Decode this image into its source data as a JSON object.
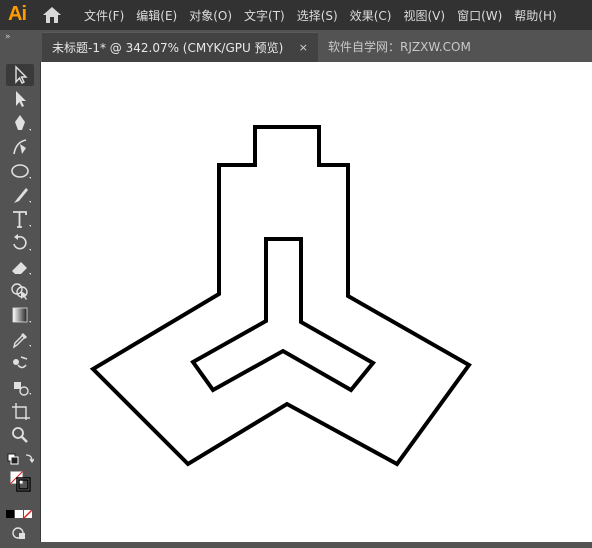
{
  "app": {
    "logo": "Ai"
  },
  "menu": [
    "文件(F)",
    "编辑(E)",
    "对象(O)",
    "文字(T)",
    "选择(S)",
    "效果(C)",
    "视图(V)",
    "窗口(W)",
    "帮助(H)"
  ],
  "tabs": {
    "active": {
      "title": "未标题-1* @ 342.07% (CMYK/GPU 预览)",
      "close": "×"
    },
    "inactive": {
      "title": "软件自学网：RJZXW.COM"
    }
  },
  "toolbar": {
    "collapse": "»",
    "tools": [
      "selection-tool",
      "direct-selection-tool",
      "pen-tool",
      "curvature-tool",
      "ellipse-tool",
      "paintbrush-tool",
      "type-tool",
      "rotate-tool",
      "eraser-tool",
      "shape-builder-tool",
      "gradient-tool",
      "eyedropper-tool",
      "blend-tool",
      "symbol-sprayer-tool",
      "artboard-tool",
      "zoom-tool"
    ]
  },
  "colors": {
    "menubar": "#323232",
    "panel": "#535353",
    "active_tab": "#424242",
    "canvas": "#ffffff",
    "stroke": "#000000",
    "logo": "#ff9a00"
  }
}
